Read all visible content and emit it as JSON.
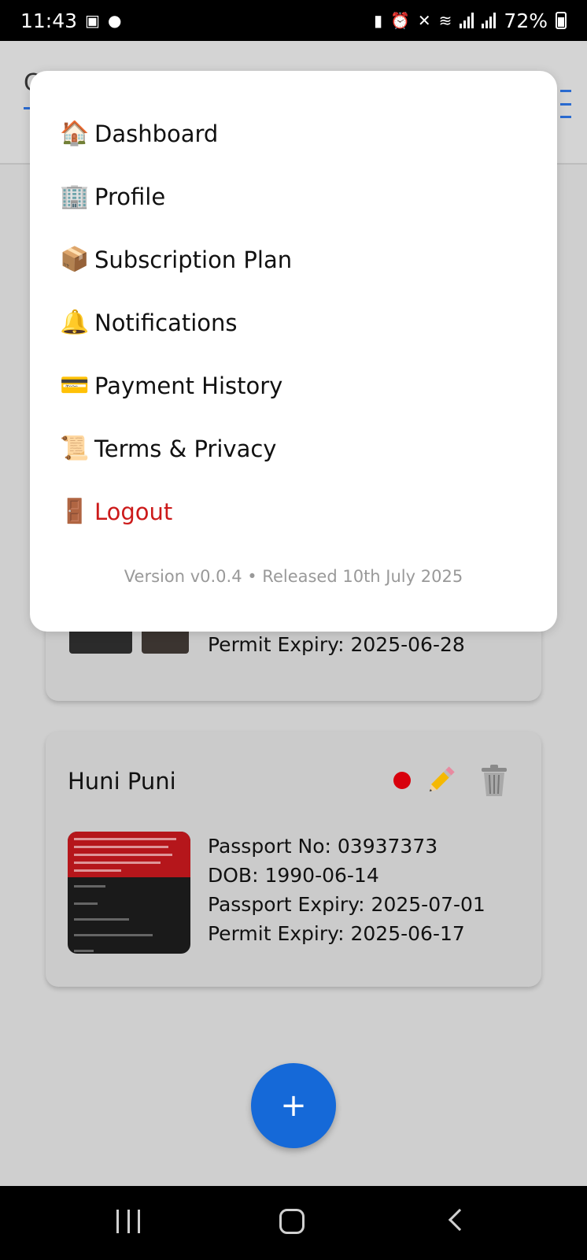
{
  "status_bar": {
    "time": "11:43",
    "battery": "72%"
  },
  "app": {
    "header_letter": "C"
  },
  "menu": {
    "items": [
      {
        "icon": "🏠",
        "label": "Dashboard"
      },
      {
        "icon": "🏢",
        "label": "Profile"
      },
      {
        "icon": "📦",
        "label": "Subscription Plan"
      },
      {
        "icon": "🔔",
        "label": "Notifications"
      },
      {
        "icon": "💳",
        "label": "Payment History"
      },
      {
        "icon": "📜",
        "label": "Terms & Privacy"
      },
      {
        "icon": "🚪",
        "label": "Logout"
      }
    ],
    "version": "Version v0.0.4 • Released 10th July 2025"
  },
  "cards": {
    "first": {
      "permit_expiry": "Permit Expiry: 2025-06-28"
    },
    "second": {
      "name": "Huni Puni",
      "status_color": "#d8000c",
      "passport_no": "Passport No: 03937373",
      "dob": "DOB: 1990-06-14",
      "passport_expiry": "Passport Expiry: 2025-07-01",
      "permit_expiry": "Permit Expiry: 2025-06-17"
    }
  },
  "fab": {
    "label": "+"
  },
  "colors": {
    "accent": "#1569d8",
    "logout": "#cc1a1a"
  }
}
